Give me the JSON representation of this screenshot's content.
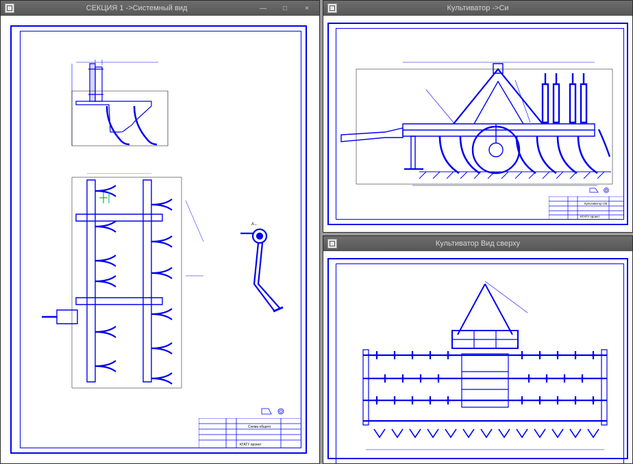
{
  "windows": {
    "left": {
      "title": "СЕКЦИЯ 1 ->Системный вид",
      "icon": "document-icon",
      "doc_label_a": "СЕКЦИЯ 1",
      "doc_label_b": "Системный вид",
      "wincontrols": {
        "minimize": "—",
        "maximize": "□",
        "close": "×"
      }
    },
    "topright": {
      "title": "Культиватор ->Си",
      "icon": "document-icon",
      "doc_label_a": "Культиватор",
      "doc_label_b": "Си"
    },
    "bottomright": {
      "title": "Культиватор Вид сверху",
      "icon": "document-icon",
      "doc_label": "Культиватор Вид сверху"
    }
  },
  "titleblock": {
    "left": {
      "project": "КГАТУ проект",
      "subtitle": "Схема общего"
    },
    "topright": {
      "project": "КГАТУ проект",
      "subtitle": "Культиватор СВ"
    }
  },
  "colors": {
    "cad_blue": "#0000ee",
    "cad_cyan": "#00a0a0",
    "cad_green": "#009900"
  }
}
